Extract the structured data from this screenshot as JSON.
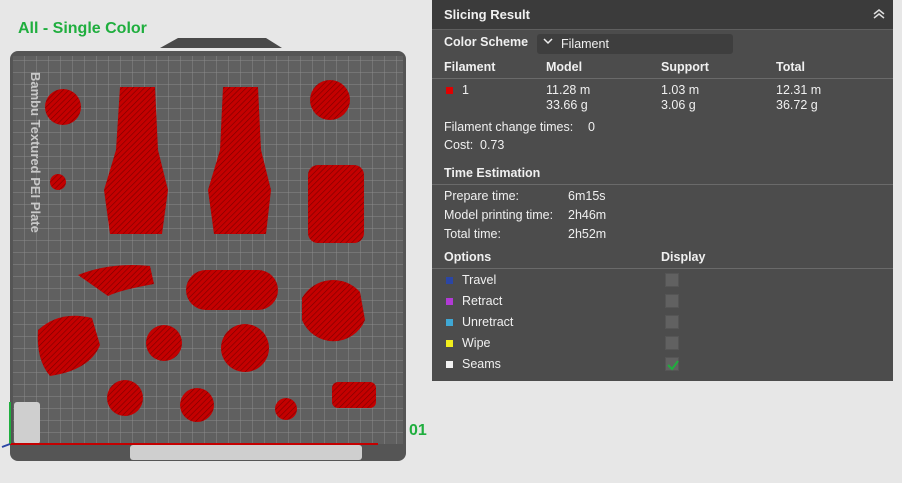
{
  "plate": {
    "title": "All - Single Color",
    "number": "01",
    "brand_text": "Bambu Textured PEI Plate"
  },
  "panel": {
    "title": "Slicing Result",
    "color_scheme_label": "Color Scheme",
    "color_scheme_value": "Filament",
    "table_headers": {
      "filament": "Filament",
      "model": "Model",
      "support": "Support",
      "total": "Total"
    },
    "filament_row": {
      "swatch_color": "#e00000",
      "id": "1",
      "model_length": "11.28 m",
      "model_weight": "33.66 g",
      "support_length": "1.03 m",
      "support_weight": "3.06 g",
      "total_length": "12.31 m",
      "total_weight": "36.72 g"
    },
    "change_times_label": "Filament change times:",
    "change_times_value": "0",
    "cost_label": "Cost:",
    "cost_value": "0.73",
    "time_section_title": "Time Estimation",
    "prepare_label": "Prepare time:",
    "prepare_value": "6m15s",
    "model_time_label": "Model printing time:",
    "model_time_value": "2h46m",
    "total_time_label": "Total time:",
    "total_time_value": "2h52m",
    "options_header": "Options",
    "display_header": "Display",
    "options": [
      {
        "label": "Travel",
        "color": "#2b46a5",
        "checked": false
      },
      {
        "label": "Retract",
        "color": "#b23ad6",
        "checked": false
      },
      {
        "label": "Unretract",
        "color": "#3fa7d4",
        "checked": false
      },
      {
        "label": "Wipe",
        "color": "#f2ee1d",
        "checked": false
      },
      {
        "label": "Seams",
        "color": "#f2f2f2",
        "checked": true
      }
    ]
  },
  "colors": {
    "accent_green": "#1fae3e",
    "model_red": "#c40000",
    "panel_bg": "#4c4c4c"
  }
}
